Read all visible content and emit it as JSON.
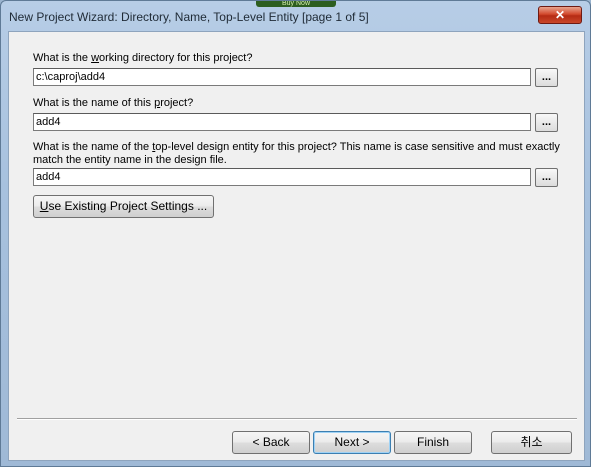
{
  "window": {
    "title": "New Project Wizard: Directory, Name, Top-Level Entity [page 1 of 5]",
    "background_banner": "Buy Now",
    "close_glyph": "✕"
  },
  "form": {
    "dir_label_pre": "What is the ",
    "dir_label_ul": "w",
    "dir_label_post": "orking directory for this project?",
    "dir_value": "c:\\caproj\\add4",
    "name_label_pre": "What is the name of this ",
    "name_label_ul": "p",
    "name_label_post": "roject?",
    "name_value": "add4",
    "entity_label_pre": "What is the name of the ",
    "entity_label_ul": "t",
    "entity_label_post": "op-level design entity for this project? This name is case sensitive and must exactly match the entity name in the design file.",
    "entity_value": "add4",
    "browse_label": "...",
    "use_existing_ul": "U",
    "use_existing_post": "se Existing Project Settings ..."
  },
  "footer": {
    "back_label": "< Back",
    "next_label": "Next >",
    "finish_label": "Finish",
    "cancel_label": "취소"
  }
}
